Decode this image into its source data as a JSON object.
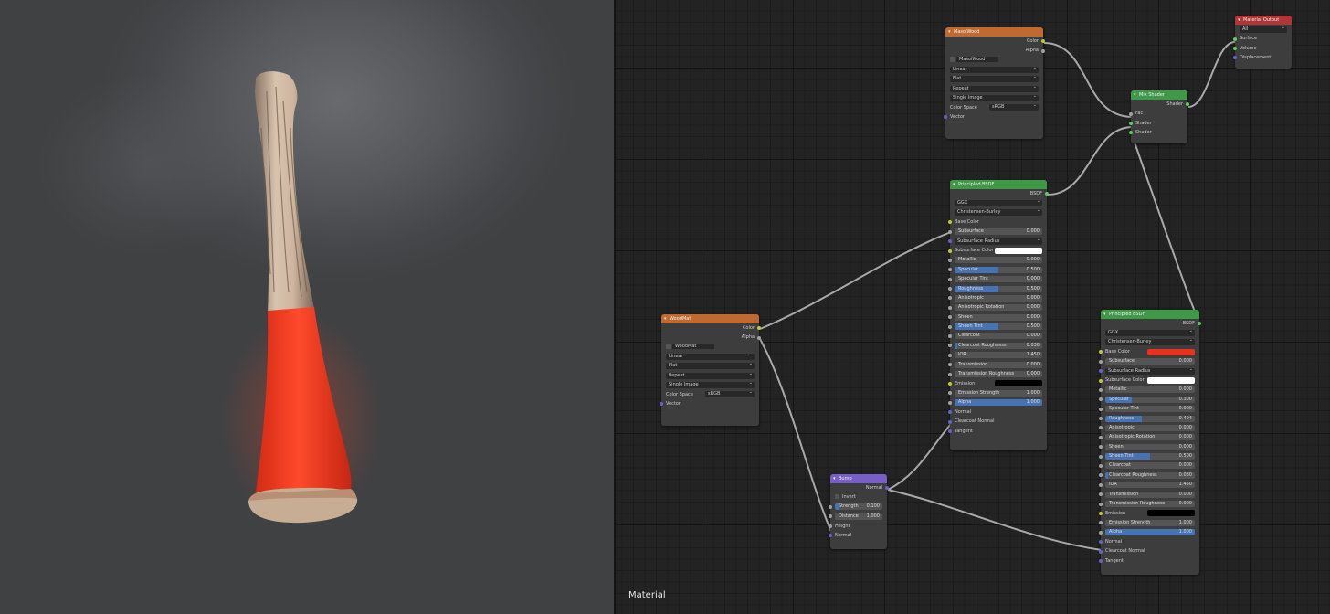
{
  "editor": {
    "label": "Material"
  },
  "nodes": {
    "masoiwood": {
      "title": "MasoiWood",
      "outputs": [
        "Color",
        "Alpha"
      ],
      "image_name": "MasoiWood",
      "selects": [
        "Linear",
        "Flat",
        "Repeat",
        "Single Image"
      ],
      "colorspace_label": "Color Space",
      "colorspace_value": "sRGB",
      "input": "Vector"
    },
    "woodmat": {
      "title": "WoodMat",
      "outputs": [
        "Color",
        "Alpha"
      ],
      "image_name": "WoodMat",
      "selects": [
        "Linear",
        "Flat",
        "Repeat",
        "Single Image"
      ],
      "colorspace_label": "Color Space",
      "colorspace_value": "sRGB",
      "input": "Vector"
    },
    "mix": {
      "title": "Mix Shader",
      "output": "Shader",
      "inputs": [
        "Fac",
        "Shader",
        "Shader"
      ]
    },
    "matout": {
      "title": "Material Output",
      "target": "All",
      "inputs": [
        "Surface",
        "Volume",
        "Displacement"
      ]
    },
    "bump": {
      "title": "Bump",
      "output": "Normal",
      "invert": "Invert",
      "strength_label": "Strength",
      "strength_value": "0.100",
      "strength_fill": 0.1,
      "distance_label": "Distance",
      "distance_value": "1.000",
      "inputs": [
        "Height",
        "Normal"
      ]
    },
    "bsdf1": {
      "title": "Principled BSDF",
      "output": "BSDF",
      "distribution": "GGX",
      "sss_method": "Christensen-Burley",
      "base_color": "Base Color",
      "subsurface_radius": "Subsurface Radius",
      "subsurface_color": "Subsurface Color",
      "subsurface_color_hex": "#ffffff",
      "emission": "Emission",
      "emission_color_hex": "#000000",
      "fields": [
        {
          "label": "Subsurface",
          "value": "0.000",
          "fill": 0
        },
        {
          "label": "Metallic",
          "value": "0.000",
          "fill": 0
        },
        {
          "label": "Specular",
          "value": "0.500",
          "fill": 0.5
        },
        {
          "label": "Specular Tint",
          "value": "0.000",
          "fill": 0
        },
        {
          "label": "Roughness",
          "value": "0.500",
          "fill": 0.5
        },
        {
          "label": "Anisotropic",
          "value": "0.000",
          "fill": 0
        },
        {
          "label": "Anisotropic Rotation",
          "value": "0.000",
          "fill": 0
        },
        {
          "label": "Sheen",
          "value": "0.000",
          "fill": 0
        },
        {
          "label": "Sheen Tint",
          "value": "0.500",
          "fill": 0.5
        },
        {
          "label": "Clearcoat",
          "value": "0.000",
          "fill": 0
        },
        {
          "label": "Clearcoat Roughness",
          "value": "0.030",
          "fill": 0.03
        },
        {
          "label": "IOR",
          "value": "1.450",
          "fill": 0
        },
        {
          "label": "Transmission",
          "value": "0.000",
          "fill": 0
        },
        {
          "label": "Transmission Roughness",
          "value": "0.000",
          "fill": 0
        },
        {
          "label": "Emission Strength",
          "value": "1.000",
          "fill": 0
        },
        {
          "label": "Alpha",
          "value": "1.000",
          "fill": 1
        }
      ],
      "inputs_tail": [
        "Normal",
        "Clearcoat Normal",
        "Tangent"
      ]
    },
    "bsdf2": {
      "title": "Principled BSDF",
      "output": "BSDF",
      "distribution": "GGX",
      "sss_method": "Christensen-Burley",
      "base_color": "Base Color",
      "base_color_hex": "#e8321f",
      "subsurface_radius": "Subsurface Radius",
      "subsurface_color": "Subsurface Color",
      "subsurface_color_hex": "#ffffff",
      "emission": "Emission",
      "emission_color_hex": "#000000",
      "fields": [
        {
          "label": "Subsurface",
          "value": "0.000",
          "fill": 0
        },
        {
          "label": "Metallic",
          "value": "0.000",
          "fill": 0
        },
        {
          "label": "Specular",
          "value": "0.300",
          "fill": 0.3
        },
        {
          "label": "Specular Tint",
          "value": "0.000",
          "fill": 0
        },
        {
          "label": "Roughness",
          "value": "0.404",
          "fill": 0.404
        },
        {
          "label": "Anisotropic",
          "value": "0.000",
          "fill": 0
        },
        {
          "label": "Anisotropic Rotation",
          "value": "0.000",
          "fill": 0
        },
        {
          "label": "Sheen",
          "value": "0.000",
          "fill": 0
        },
        {
          "label": "Sheen Tint",
          "value": "0.500",
          "fill": 0.5
        },
        {
          "label": "Clearcoat",
          "value": "0.000",
          "fill": 0
        },
        {
          "label": "Clearcoat Roughness",
          "value": "0.030",
          "fill": 0.03
        },
        {
          "label": "IOR",
          "value": "1.450",
          "fill": 0
        },
        {
          "label": "Transmission",
          "value": "0.000",
          "fill": 0
        },
        {
          "label": "Transmission Roughness",
          "value": "0.000",
          "fill": 0
        },
        {
          "label": "Emission Strength",
          "value": "1.000",
          "fill": 0
        },
        {
          "label": "Alpha",
          "value": "1.000",
          "fill": 1
        }
      ],
      "inputs_tail": [
        "Normal",
        "Clearcoat Normal",
        "Tangent"
      ]
    }
  },
  "colors": {
    "texture_header": "#c06a32",
    "shader_header": "#3f9a47",
    "vector_header": "#7a5ec8",
    "output_header": "#b03539",
    "field_fill": "#4772b3",
    "handle_red": "#e8321f"
  }
}
